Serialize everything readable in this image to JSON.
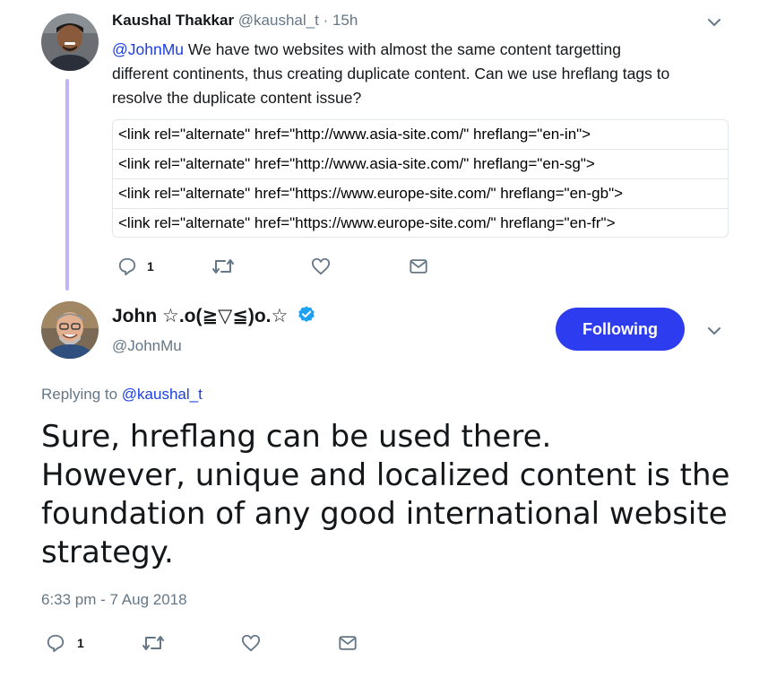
{
  "parent_tweet": {
    "author_name": "Kaushal Thakkar",
    "author_handle": "@kaushal_t",
    "separator": "·",
    "time": "15h",
    "mention": "@JohnMu",
    "text_line1": " We have two websites with almost the same content targetting",
    "text_line2": "different continents, thus creating duplicate content. Can we use hreflang tags to",
    "text_line3": "resolve the duplicate content issue?",
    "code_lines": [
      "<link rel=\"alternate\" href=\"http://www.asia-site.com/\" hreflang=\"en-in\">",
      "<link rel=\"alternate\" href=\"http://www.asia-site.com/\" hreflang=\"en-sg\">",
      "<link rel=\"alternate\" href=\"https://www.europe-site.com/\" hreflang=\"en-gb\">",
      "<link rel=\"alternate\" href=\"https://www.europe-site.com/\" hreflang=\"en-fr\">"
    ],
    "reply_count": "1",
    "icons": {
      "reply": "reply-icon",
      "retweet": "retweet-icon",
      "like": "heart-icon",
      "dm": "envelope-icon",
      "menu": "chevron-down-icon"
    }
  },
  "main_tweet": {
    "author_name": "John ☆.o(≧▽≦)o.☆",
    "author_handle": "@JohnMu",
    "follow_label": "Following",
    "replying_to_label": "Replying to ",
    "replying_to_handle": "@kaushal_t",
    "text_lines": [
      "Sure, hreflang can be used there.",
      "However, unique and localized content is the",
      "foundation of any good international website",
      "strategy."
    ],
    "timestamp": "6:33 pm - 7 Aug 2018",
    "reply_count": "1",
    "icons": {
      "verified": "verified-badge-icon",
      "menu": "chevron-down-icon"
    }
  },
  "colors": {
    "accent_blue": "#2e3cf0",
    "link_blue": "#1b3fe0",
    "thread_line": "#c5b3f7",
    "verified": "#1da1f2",
    "muted": "#657786"
  }
}
